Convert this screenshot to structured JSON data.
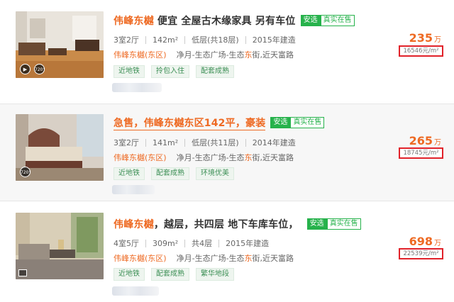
{
  "listings": [
    {
      "title_parts": [
        "伟峰东樾",
        " 便宜 全屋古木缘家具 另有车位"
      ],
      "badge_a": "安选",
      "badge_b": "真实在售",
      "layout": "3室2厅",
      "area": "142m²",
      "floor": "低层(共18层)",
      "year": "2015年建造",
      "community": "伟峰东樾(东区)",
      "address_parts": [
        "净月-生态广场-生态",
        "东",
        "街,近天富路"
      ],
      "tags": [
        "近地铁",
        "拎包入住",
        "配套成熟"
      ],
      "price": "235",
      "price_unit": "万",
      "unit_price": "16546元/m²",
      "photo_icons": [
        "play-icon",
        "vr-720-icon"
      ],
      "vr_label": "720°"
    },
    {
      "title_parts": [
        "急售，伟峰东樾东区142平，豪装"
      ],
      "badge_a": "安选",
      "badge_b": "真实在售",
      "layout": "3室2厅",
      "area": "141m²",
      "floor": "低层(共11层)",
      "year": "2014年建造",
      "community": "伟峰东樾(东区)",
      "address_parts": [
        "净月-生态广场-生态",
        "东",
        "街,近天富路"
      ],
      "tags": [
        "近地铁",
        "配套成熟",
        "环境优美"
      ],
      "price": "265",
      "price_unit": "万",
      "unit_price": "18745元/m²",
      "vr_label": "720°"
    },
    {
      "title_parts": [
        "伟峰东樾",
        "，越层，共四层 地下车库车位，"
      ],
      "badge_a": "安选",
      "badge_b": "真实在售",
      "layout": "4室5厅",
      "area": "309m²",
      "floor": "共4层",
      "year": "2015年建造",
      "community": "伟峰东樾(东区)",
      "address_parts": [
        "净月-生态广场-生态",
        "东",
        "街,近天富路"
      ],
      "tags": [
        "近地铁",
        "配套成熟",
        "繁华地段"
      ],
      "price": "698",
      "price_unit": "万",
      "unit_price": "22539元/m²"
    }
  ],
  "colors": {
    "accent": "#ee6a23",
    "badge_green": "#26b24b",
    "highlight_box": "#e1222a"
  }
}
